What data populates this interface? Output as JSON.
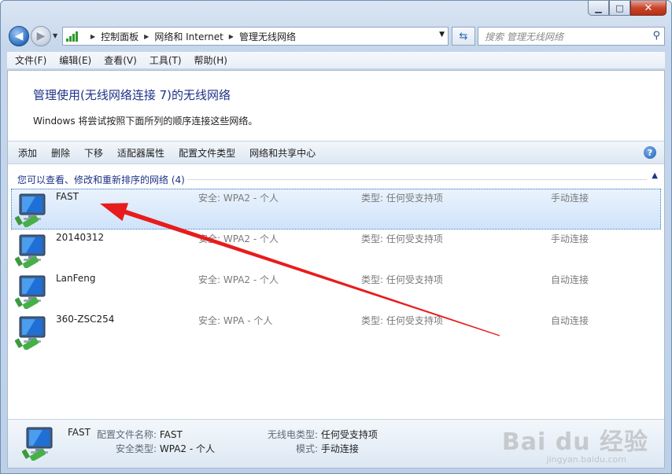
{
  "window": {
    "minimize_glyph": "▁",
    "maximize_glyph": "□",
    "close_glyph": "✕"
  },
  "address": {
    "crumbs": [
      "控制面板",
      "网络和 Internet",
      "管理无线网络"
    ],
    "search_placeholder": "搜索 管理无线网络"
  },
  "menu": [
    "文件(F)",
    "编辑(E)",
    "查看(V)",
    "工具(T)",
    "帮助(H)"
  ],
  "header": {
    "title": "管理使用(无线网络连接 7)的无线网络",
    "description": "Windows 将尝试按照下面所列的顺序连接这些网络。"
  },
  "toolbar": {
    "items": [
      "添加",
      "删除",
      "下移",
      "适配器属性",
      "配置文件类型",
      "网络和共享中心"
    ],
    "help_glyph": "?"
  },
  "group": {
    "label": "您可以查看、修改和重新排序的网络 (4)"
  },
  "networks": [
    {
      "name": "FAST",
      "security": "安全: WPA2 - 个人",
      "type": "类型: 任何受支持项",
      "mode": "手动连接",
      "selected": true
    },
    {
      "name": "20140312",
      "security": "安全: WPA2 - 个人",
      "type": "类型: 任何受支持项",
      "mode": "手动连接",
      "selected": false
    },
    {
      "name": "LanFeng",
      "security": "安全: WPA2 - 个人",
      "type": "类型: 任何受支持项",
      "mode": "自动连接",
      "selected": false
    },
    {
      "name": "360-ZSC254",
      "security": "安全: WPA - 个人",
      "type": "类型: 任何受支持项",
      "mode": "自动连接",
      "selected": false
    }
  ],
  "details": {
    "name": "FAST",
    "profile_label": "配置文件名称:",
    "profile_value": "FAST",
    "security_label": "安全类型:",
    "security_value": "WPA2 - 个人",
    "radio_label": "无线电类型:",
    "radio_value": "任何受支持项",
    "mode_label": "模式:",
    "mode_value": "手动连接"
  },
  "watermark": {
    "main": "Bai du 经验",
    "sub": "jingyan.baidu.com"
  },
  "colors": {
    "accent_title": "#1e3287",
    "selection": "#cfe3fa",
    "annotation_arrow": "#e81c1c"
  }
}
